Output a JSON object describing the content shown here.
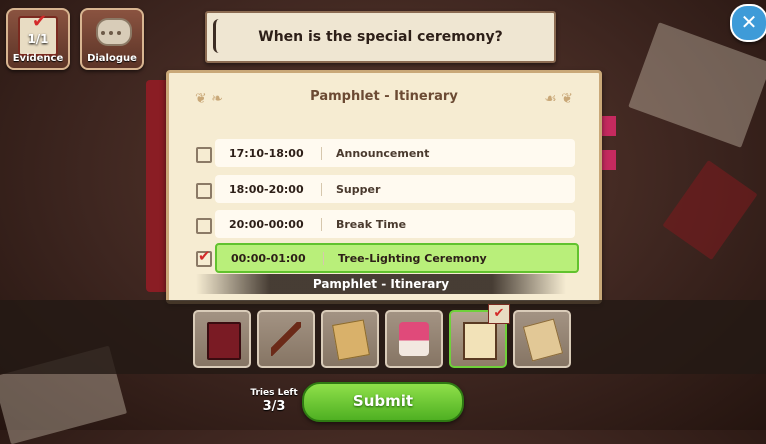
{
  "hud": {
    "evidence": {
      "label": "Evidence",
      "count": "1/1"
    },
    "dialogue": {
      "label": "Dialogue"
    }
  },
  "question": "When is the special ceremony?",
  "close_icon": "close-icon",
  "pamphlet": {
    "title": "Pamphlet - Itinerary",
    "rows": [
      {
        "time": "17:10-18:00",
        "event": "Announcement",
        "checked": false
      },
      {
        "time": "18:00-20:00",
        "event": "Supper",
        "checked": false
      },
      {
        "time": "20:00-00:00",
        "event": "Break Time",
        "checked": false
      },
      {
        "time": "00:00-01:00",
        "event": "Tree-Lighting Ceremony",
        "checked": true
      }
    ],
    "caption": "Pamphlet - Itinerary"
  },
  "evidence_slots": [
    {
      "icon": "red-book-icon",
      "selected": false
    },
    {
      "icon": "key-icon",
      "selected": false
    },
    {
      "icon": "envelope-icon",
      "selected": false
    },
    {
      "icon": "cake-icon",
      "selected": false
    },
    {
      "icon": "pamphlet-icon",
      "selected": true
    },
    {
      "icon": "map-scroll-icon",
      "selected": false
    }
  ],
  "tries": {
    "label": "Tries Left",
    "value": "3/3"
  },
  "submit_label": "Submit",
  "colors": {
    "accent_green": "#61c22e",
    "check_red": "#d42a2a",
    "close_blue": "#3e9bd8"
  }
}
